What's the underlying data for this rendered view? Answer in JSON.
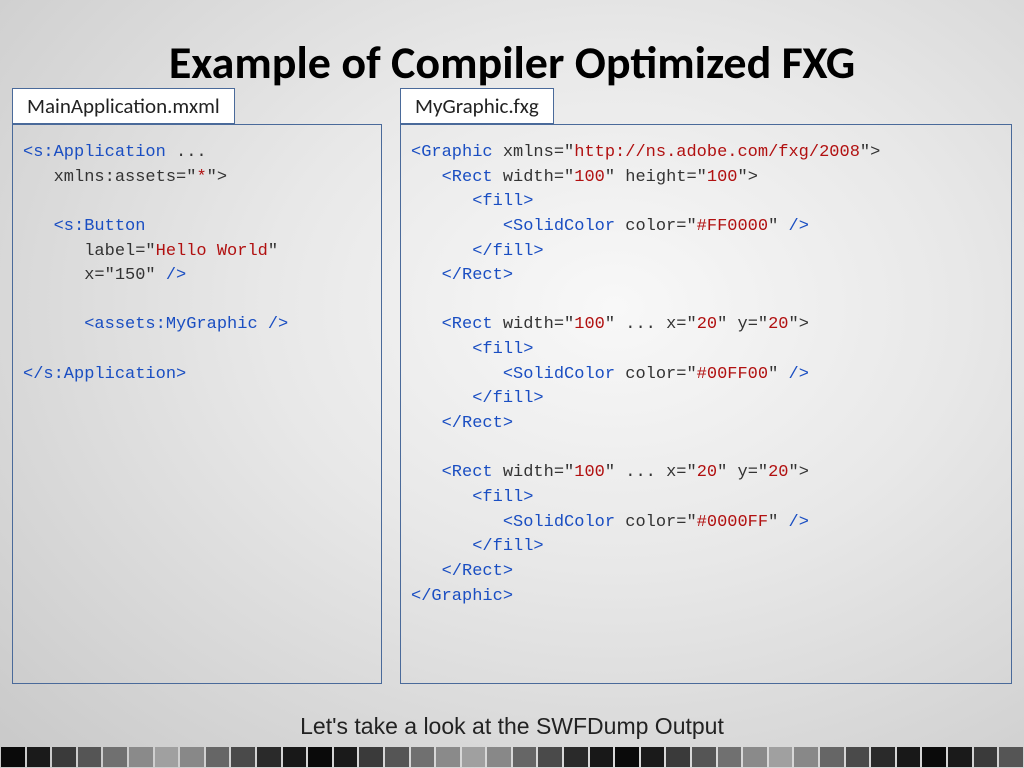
{
  "title": "Example of Compiler Optimized FXG",
  "left": {
    "title": "MainApplication.mxml",
    "lines": [
      [
        {
          "c": "tag",
          "t": "<s:Application "
        },
        {
          "c": "txt",
          "t": "..."
        }
      ],
      [
        {
          "c": "txt",
          "t": "   xmlns:assets=\""
        },
        {
          "c": "attr",
          "t": "*"
        },
        {
          "c": "txt",
          "t": "\">"
        }
      ],
      [],
      [
        {
          "c": "txt",
          "t": "   "
        },
        {
          "c": "tag",
          "t": "<s:Button"
        }
      ],
      [
        {
          "c": "txt",
          "t": "      label=\""
        },
        {
          "c": "attr",
          "t": "Hello World"
        },
        {
          "c": "txt",
          "t": "\""
        }
      ],
      [
        {
          "c": "txt",
          "t": "      x=\"150\" "
        },
        {
          "c": "tag",
          "t": "/>"
        }
      ],
      [],
      [
        {
          "c": "txt",
          "t": "      "
        },
        {
          "c": "tag",
          "t": "<assets:MyGraphic />"
        }
      ],
      [],
      [
        {
          "c": "tag",
          "t": "</s:Application>"
        }
      ]
    ]
  },
  "right": {
    "title": "MyGraphic.fxg",
    "lines": [
      [
        {
          "c": "tag",
          "t": "<Graphic "
        },
        {
          "c": "txt",
          "t": "xmlns=\""
        },
        {
          "c": "attr",
          "t": "http://ns.adobe.com/fxg/2008"
        },
        {
          "c": "txt",
          "t": "\">"
        }
      ],
      [
        {
          "c": "txt",
          "t": "   "
        },
        {
          "c": "tag",
          "t": "<Rect "
        },
        {
          "c": "txt",
          "t": "width=\""
        },
        {
          "c": "attr",
          "t": "100"
        },
        {
          "c": "txt",
          "t": "\" height=\""
        },
        {
          "c": "attr",
          "t": "100"
        },
        {
          "c": "txt",
          "t": "\">"
        }
      ],
      [
        {
          "c": "txt",
          "t": "      "
        },
        {
          "c": "tag",
          "t": "<fill>"
        }
      ],
      [
        {
          "c": "txt",
          "t": "         "
        },
        {
          "c": "tag",
          "t": "<SolidColor "
        },
        {
          "c": "txt",
          "t": "color=\""
        },
        {
          "c": "attr",
          "t": "#FF0000"
        },
        {
          "c": "txt",
          "t": "\" "
        },
        {
          "c": "tag",
          "t": "/>"
        }
      ],
      [
        {
          "c": "txt",
          "t": "      "
        },
        {
          "c": "tag",
          "t": "</fill>"
        }
      ],
      [
        {
          "c": "txt",
          "t": "   "
        },
        {
          "c": "tag",
          "t": "</Rect>"
        }
      ],
      [],
      [
        {
          "c": "txt",
          "t": "   "
        },
        {
          "c": "tag",
          "t": "<Rect "
        },
        {
          "c": "txt",
          "t": "width=\""
        },
        {
          "c": "attr",
          "t": "100"
        },
        {
          "c": "txt",
          "t": "\" ... x=\""
        },
        {
          "c": "attr",
          "t": "20"
        },
        {
          "c": "txt",
          "t": "\" y=\""
        },
        {
          "c": "attr",
          "t": "20"
        },
        {
          "c": "txt",
          "t": "\">"
        }
      ],
      [
        {
          "c": "txt",
          "t": "      "
        },
        {
          "c": "tag",
          "t": "<fill>"
        }
      ],
      [
        {
          "c": "txt",
          "t": "         "
        },
        {
          "c": "tag",
          "t": "<SolidColor "
        },
        {
          "c": "txt",
          "t": "color=\""
        },
        {
          "c": "attr",
          "t": "#00FF00"
        },
        {
          "c": "txt",
          "t": "\" "
        },
        {
          "c": "tag",
          "t": "/>"
        }
      ],
      [
        {
          "c": "txt",
          "t": "      "
        },
        {
          "c": "tag",
          "t": "</fill>"
        }
      ],
      [
        {
          "c": "txt",
          "t": "   "
        },
        {
          "c": "tag",
          "t": "</Rect>"
        }
      ],
      [],
      [
        {
          "c": "txt",
          "t": "   "
        },
        {
          "c": "tag",
          "t": "<Rect "
        },
        {
          "c": "txt",
          "t": "width=\""
        },
        {
          "c": "attr",
          "t": "100"
        },
        {
          "c": "txt",
          "t": "\" ... x=\""
        },
        {
          "c": "attr",
          "t": "20"
        },
        {
          "c": "txt",
          "t": "\" y=\""
        },
        {
          "c": "attr",
          "t": "20"
        },
        {
          "c": "txt",
          "t": "\">"
        }
      ],
      [
        {
          "c": "txt",
          "t": "      "
        },
        {
          "c": "tag",
          "t": "<fill>"
        }
      ],
      [
        {
          "c": "txt",
          "t": "         "
        },
        {
          "c": "tag",
          "t": "<SolidColor "
        },
        {
          "c": "txt",
          "t": "color=\""
        },
        {
          "c": "attr",
          "t": "#0000FF"
        },
        {
          "c": "txt",
          "t": "\" "
        },
        {
          "c": "tag",
          "t": "/>"
        }
      ],
      [
        {
          "c": "txt",
          "t": "      "
        },
        {
          "c": "tag",
          "t": "</fill>"
        }
      ],
      [
        {
          "c": "txt",
          "t": "   "
        },
        {
          "c": "tag",
          "t": "</Rect>"
        }
      ],
      [
        {
          "c": "tag",
          "t": "</Graphic>"
        }
      ]
    ]
  },
  "footer": "Let's take a look at the SWFDump Output",
  "squares": [
    "#0a0a0a",
    "#1a1a1a",
    "#3a3a3a",
    "#555",
    "#707070",
    "#8a8a8a",
    "#a0a0a0",
    "#888",
    "#666",
    "#4a4a4a",
    "#2a2a2a",
    "#181818",
    "#0a0a0a",
    "#1a1a1a",
    "#3a3a3a",
    "#555",
    "#707070",
    "#8a8a8a",
    "#a0a0a0",
    "#888",
    "#666",
    "#4a4a4a",
    "#2a2a2a",
    "#181818",
    "#0a0a0a",
    "#1a1a1a",
    "#3a3a3a",
    "#555",
    "#707070",
    "#8a8a8a",
    "#a0a0a0",
    "#888",
    "#666",
    "#4a4a4a",
    "#2a2a2a",
    "#181818",
    "#0a0a0a",
    "#1a1a1a",
    "#3a3a3a",
    "#555"
  ]
}
